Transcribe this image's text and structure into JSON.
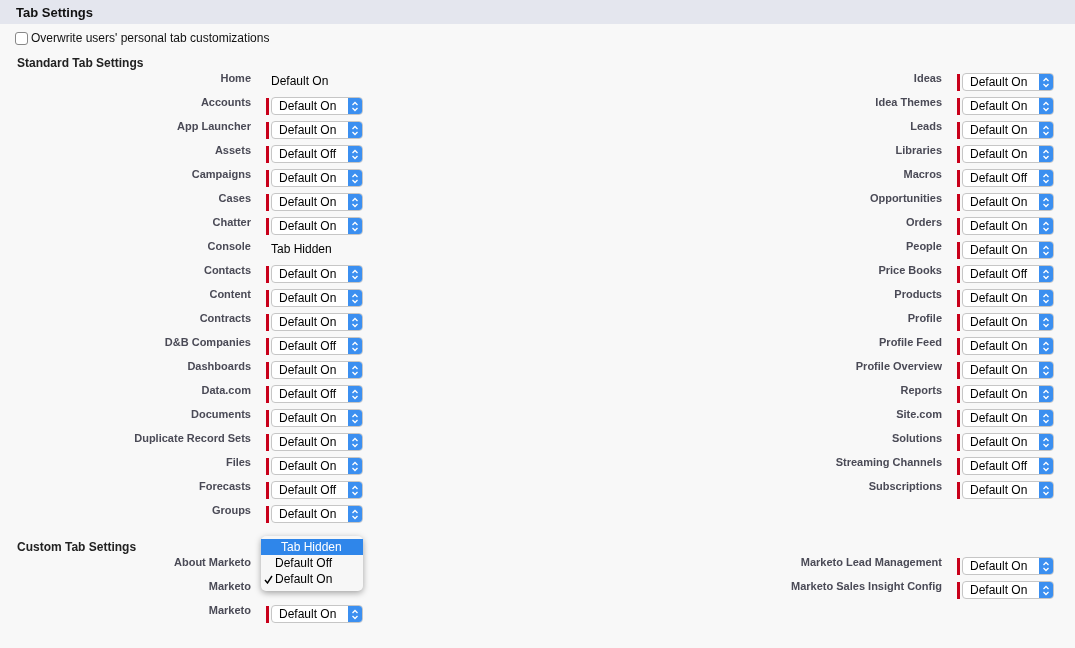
{
  "header": {
    "title": "Tab Settings"
  },
  "overwrite": {
    "label": "Overwrite users' personal tab customizations",
    "checked": false
  },
  "standard": {
    "title": "Standard Tab Settings",
    "left": [
      {
        "label": "Home",
        "kind": "text",
        "value": "Default On"
      },
      {
        "label": "Accounts",
        "kind": "select",
        "value": "Default On"
      },
      {
        "label": "App Launcher",
        "kind": "select",
        "value": "Default On"
      },
      {
        "label": "Assets",
        "kind": "select",
        "value": "Default Off"
      },
      {
        "label": "Campaigns",
        "kind": "select",
        "value": "Default On"
      },
      {
        "label": "Cases",
        "kind": "select",
        "value": "Default On"
      },
      {
        "label": "Chatter",
        "kind": "select",
        "value": "Default On"
      },
      {
        "label": "Console",
        "kind": "text",
        "value": "Tab Hidden"
      },
      {
        "label": "Contacts",
        "kind": "select",
        "value": "Default On"
      },
      {
        "label": "Content",
        "kind": "select",
        "value": "Default On"
      },
      {
        "label": "Contracts",
        "kind": "select",
        "value": "Default On"
      },
      {
        "label": "D&B Companies",
        "kind": "select",
        "value": "Default Off"
      },
      {
        "label": "Dashboards",
        "kind": "select",
        "value": "Default On"
      },
      {
        "label": "Data.com",
        "kind": "select",
        "value": "Default Off"
      },
      {
        "label": "Documents",
        "kind": "select",
        "value": "Default On"
      },
      {
        "label": "Duplicate Record Sets",
        "kind": "select",
        "value": "Default On"
      },
      {
        "label": "Files",
        "kind": "select",
        "value": "Default On"
      },
      {
        "label": "Forecasts",
        "kind": "select",
        "value": "Default Off"
      },
      {
        "label": "Groups",
        "kind": "select",
        "value": "Default On"
      }
    ],
    "right": [
      {
        "label": "Ideas",
        "kind": "select",
        "value": "Default On"
      },
      {
        "label": "Idea Themes",
        "kind": "select",
        "value": "Default On"
      },
      {
        "label": "Leads",
        "kind": "select",
        "value": "Default On"
      },
      {
        "label": "Libraries",
        "kind": "select",
        "value": "Default On"
      },
      {
        "label": "Macros",
        "kind": "select",
        "value": "Default Off"
      },
      {
        "label": "Opportunities",
        "kind": "select",
        "value": "Default On"
      },
      {
        "label": "Orders",
        "kind": "select",
        "value": "Default On"
      },
      {
        "label": "People",
        "kind": "select",
        "value": "Default On"
      },
      {
        "label": "Price Books",
        "kind": "select",
        "value": "Default Off"
      },
      {
        "label": "Products",
        "kind": "select",
        "value": "Default On"
      },
      {
        "label": "Profile",
        "kind": "select",
        "value": "Default On"
      },
      {
        "label": "Profile Feed",
        "kind": "select",
        "value": "Default On"
      },
      {
        "label": "Profile Overview",
        "kind": "select",
        "value": "Default On"
      },
      {
        "label": "Reports",
        "kind": "select",
        "value": "Default On"
      },
      {
        "label": "Site.com",
        "kind": "select",
        "value": "Default On"
      },
      {
        "label": "Solutions",
        "kind": "select",
        "value": "Default On"
      },
      {
        "label": "Streaming Channels",
        "kind": "select",
        "value": "Default Off"
      },
      {
        "label": "Subscriptions",
        "kind": "select",
        "value": "Default On"
      }
    ]
  },
  "custom": {
    "title": "Custom Tab Settings",
    "left": [
      {
        "label": "About Marketo",
        "kind": "menu",
        "options": [
          {
            "label": "Tab Hidden",
            "selected": true,
            "checked": false
          },
          {
            "label": "Default Off",
            "selected": false,
            "checked": false
          },
          {
            "label": "Default On",
            "selected": false,
            "checked": true
          }
        ]
      },
      {
        "label": "Marketo",
        "kind": "covered"
      },
      {
        "label": "Marketo",
        "kind": "select",
        "value": "Default On"
      }
    ],
    "right": [
      {
        "label": "Marketo Lead Management",
        "kind": "select",
        "value": "Default On"
      },
      {
        "label": "Marketo Sales Insight Config",
        "kind": "select",
        "value": "Default On"
      }
    ]
  }
}
